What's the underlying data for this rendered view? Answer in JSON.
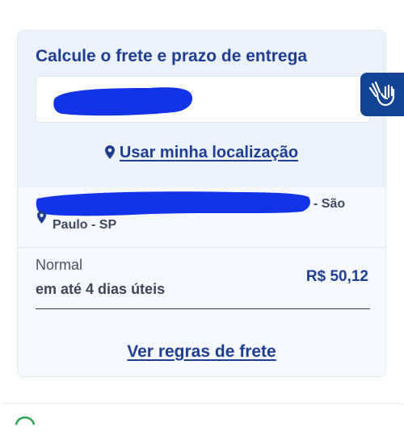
{
  "shipping": {
    "title": "Calcule o frete e prazo de entrega",
    "cep_input": {
      "value": ""
    },
    "use_location_label": "Usar minha localização",
    "address": {
      "tail": "- São",
      "city_state": "Paulo - SP"
    },
    "option": {
      "name": "Normal",
      "delivery_time": "em até 4 dias úteis",
      "price": "R$ 50,12"
    },
    "rules_link": "Ver regras de frete"
  },
  "colors": {
    "primary": "#1c3f91",
    "redaction": "#1233e8",
    "accessibility_button": "#124493",
    "card_background": "#f5f8fc"
  },
  "icons": {
    "location": "location-pin-icon",
    "accessibility": "sign-language-hands-icon"
  }
}
